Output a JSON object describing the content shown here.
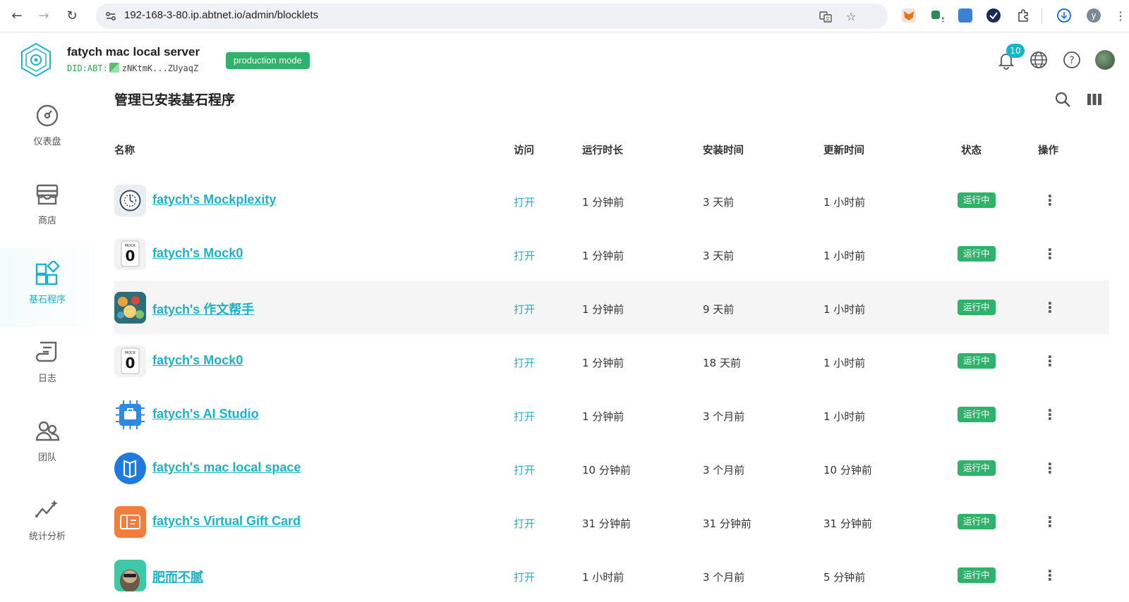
{
  "browser": {
    "url": "192-168-3-80.ip.abtnet.io/admin/blocklets",
    "profile_initial": "y",
    "extension_badge": "5"
  },
  "header": {
    "server_name": "fatych mac local server",
    "did_prefix": "DID:ABT:",
    "did_value": "zNKtmK...ZUyaqZ",
    "mode_badge": "production mode",
    "notification_count": "10"
  },
  "sidebar": {
    "items": [
      {
        "label": "仪表盘",
        "icon": "dashboard-icon"
      },
      {
        "label": "商店",
        "icon": "store-icon"
      },
      {
        "label": "基石程序",
        "icon": "blocklets-icon",
        "active": true
      },
      {
        "label": "日志",
        "icon": "logs-icon"
      },
      {
        "label": "团队",
        "icon": "team-icon"
      },
      {
        "label": "统计分析",
        "icon": "analytics-icon"
      }
    ]
  },
  "main": {
    "title": "管理已安装基石程序",
    "columns": [
      "名称",
      "访问",
      "运行时长",
      "安装时间",
      "更新时间",
      "状态",
      "操作"
    ],
    "rows": [
      {
        "name": "fatych's Mockplexity",
        "access": "打开",
        "uptime": "1 分钟前",
        "installed": "3 天前",
        "updated": "1 小时前",
        "status": "运行中",
        "icon": "mockplexity-icon"
      },
      {
        "name": "fatych's Mock0",
        "access": "打开",
        "uptime": "1 分钟前",
        "installed": "3 天前",
        "updated": "1 小时前",
        "status": "运行中",
        "icon": "mock0-icon"
      },
      {
        "name": "fatych's 作文帮手",
        "access": "打开",
        "uptime": "1 分钟前",
        "installed": "9 天前",
        "updated": "1 小时前",
        "status": "运行中",
        "icon": "essay-helper-icon"
      },
      {
        "name": "fatych's Mock0",
        "access": "打开",
        "uptime": "1 分钟前",
        "installed": "18 天前",
        "updated": "1 小时前",
        "status": "运行中",
        "icon": "mock0-icon"
      },
      {
        "name": "fatych's AI Studio",
        "access": "打开",
        "uptime": "1 分钟前",
        "installed": "3 个月前",
        "updated": "1 小时前",
        "status": "运行中",
        "icon": "ai-studio-icon"
      },
      {
        "name": "fatych's mac local space",
        "access": "打开",
        "uptime": "10 分钟前",
        "installed": "3 个月前",
        "updated": "10 分钟前",
        "status": "运行中",
        "icon": "local-space-icon"
      },
      {
        "name": "fatych's Virtual Gift Card",
        "access": "打开",
        "uptime": "31 分钟前",
        "installed": "31 分钟前",
        "updated": "31 分钟前",
        "status": "运行中",
        "icon": "gift-card-icon"
      },
      {
        "name": "肥而不腻",
        "access": "打开",
        "uptime": "1 小时前",
        "installed": "3 个月前",
        "updated": "5 分钟前",
        "status": "运行中",
        "icon": "sloth-avatar-icon"
      }
    ]
  },
  "colors": {
    "accent": "#1bb3c8",
    "status_green": "#2fb26a"
  }
}
